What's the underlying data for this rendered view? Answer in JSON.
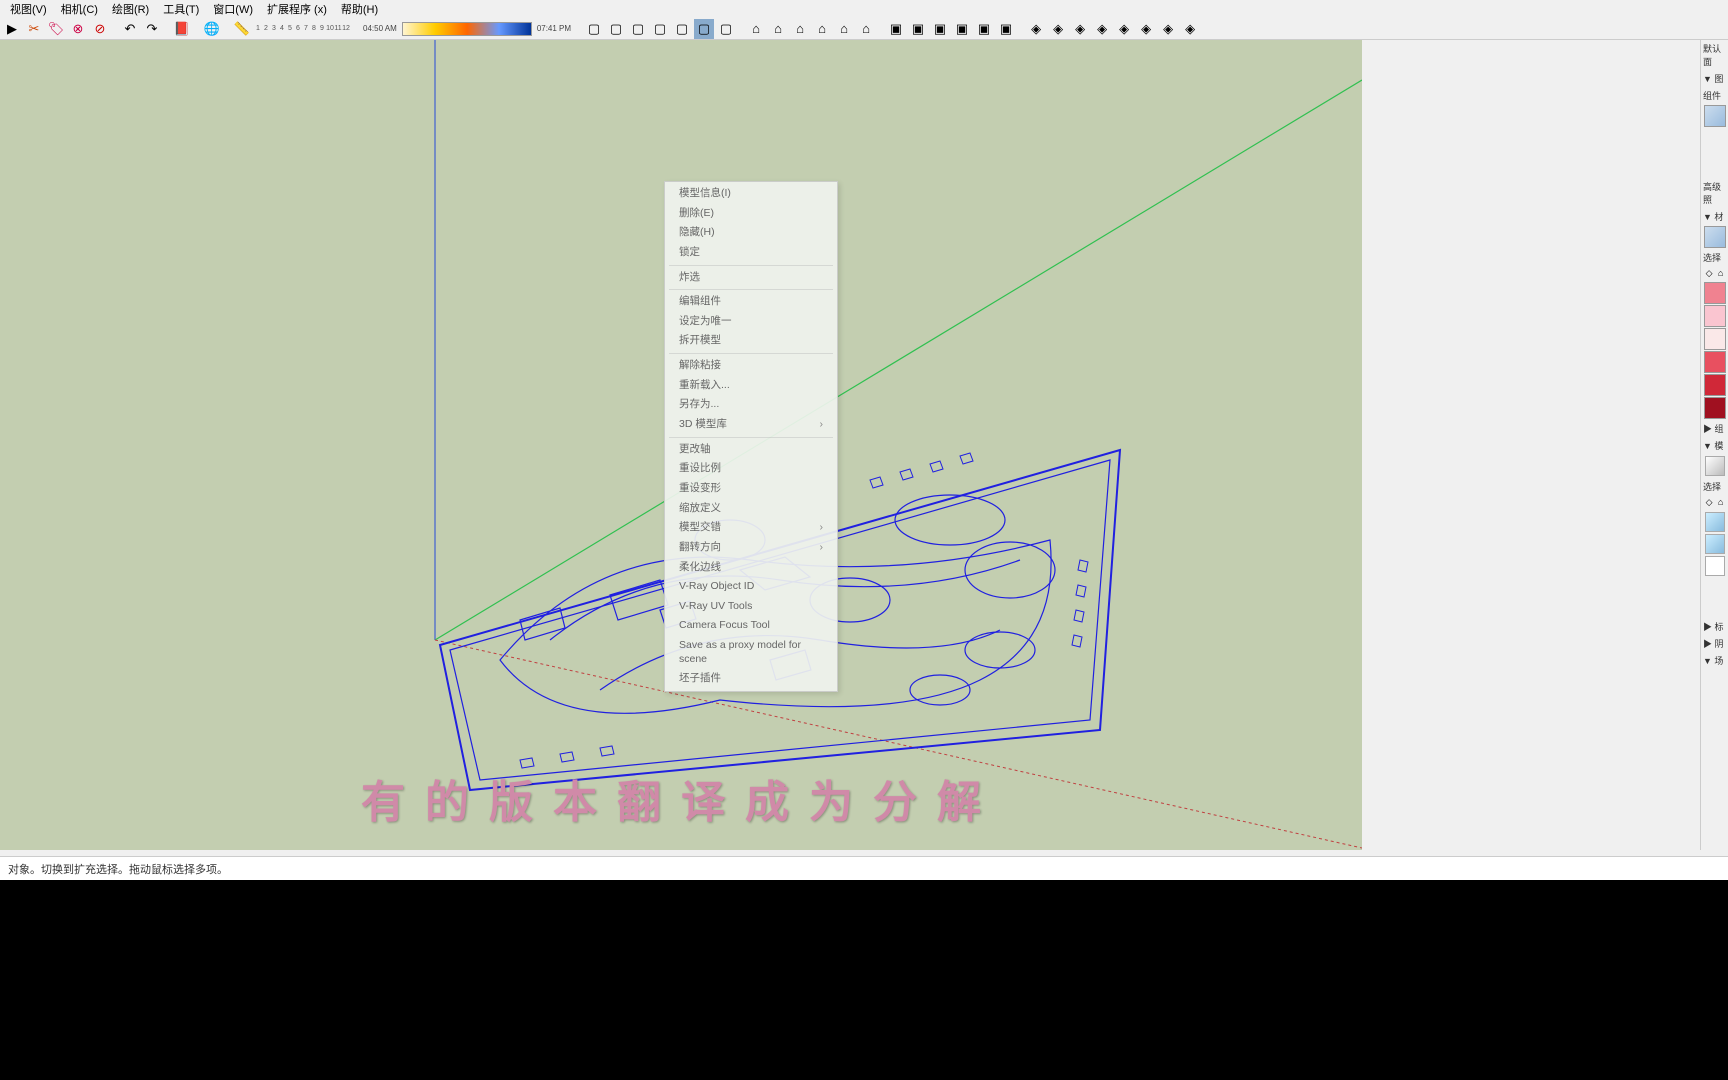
{
  "menu": {
    "view": "视图(V)",
    "camera": "相机(C)",
    "draw": "绘图(R)",
    "tools": "工具(T)",
    "window": "窗口(W)",
    "extensions": "扩展程序 (x)",
    "help": "帮助(H)"
  },
  "toolbar": {
    "time_start": "04:50 AM",
    "time_end": "07:41 PM",
    "scale": [
      "1",
      "2",
      "3",
      "4",
      "5",
      "6",
      "7",
      "8",
      "9",
      "10",
      "11",
      "12"
    ]
  },
  "context_menu": {
    "items": [
      {
        "label": "模型信息(I)",
        "sep": false
      },
      {
        "label": "删除(E)",
        "sep": false
      },
      {
        "label": "隐藏(H)",
        "sep": false
      },
      {
        "label": "锁定",
        "sep": true
      },
      {
        "label": "炸选",
        "sep": true
      },
      {
        "label": "编辑组件",
        "sep": false
      },
      {
        "label": "设定为唯一",
        "sep": false
      },
      {
        "label": "拆开模型",
        "sep": true
      },
      {
        "label": "解除粘接",
        "sep": false
      },
      {
        "label": "重新载入...",
        "sep": false
      },
      {
        "label": "另存为...",
        "sep": false
      },
      {
        "label": "3D 模型库",
        "submenu": true,
        "sep": true
      },
      {
        "label": "更改轴",
        "sep": false
      },
      {
        "label": "重设比例",
        "sep": false
      },
      {
        "label": "重设变形",
        "sep": false
      },
      {
        "label": "缩放定义",
        "sep": false
      },
      {
        "label": "模型交错",
        "submenu": true,
        "sep": false
      },
      {
        "label": "翻转方向",
        "submenu": true,
        "sep": false
      },
      {
        "label": "柔化边线",
        "sep": false
      },
      {
        "label": "V-Ray Object ID",
        "sep": false
      },
      {
        "label": "V-Ray UV Tools",
        "sep": false
      },
      {
        "label": "Camera Focus Tool",
        "sep": false
      },
      {
        "label": "Save as a proxy model for scene",
        "sep": false
      },
      {
        "label": "坯子插件",
        "sep": false
      }
    ]
  },
  "right_panel": {
    "default": "默认面",
    "layers": "▼ 图",
    "component": "组件",
    "advanced": "高级照",
    "materials": "▼ 材",
    "select": "选择",
    "comp2": "▶ 组",
    "model": "▼ 模",
    "select2": "选择",
    "section1": "▶ 标",
    "section2": "▶ 阴",
    "section3": "▼ 场",
    "colors": [
      "#f08290",
      "#fac5d0",
      "#fae8e8",
      "#e85060",
      "#d02838",
      "#a01020"
    ]
  },
  "statusbar": {
    "text": "对象。切换到扩充选择。拖动鼠标选择多项。"
  },
  "subtitle": {
    "text": "有的版本翻译成为分解"
  }
}
